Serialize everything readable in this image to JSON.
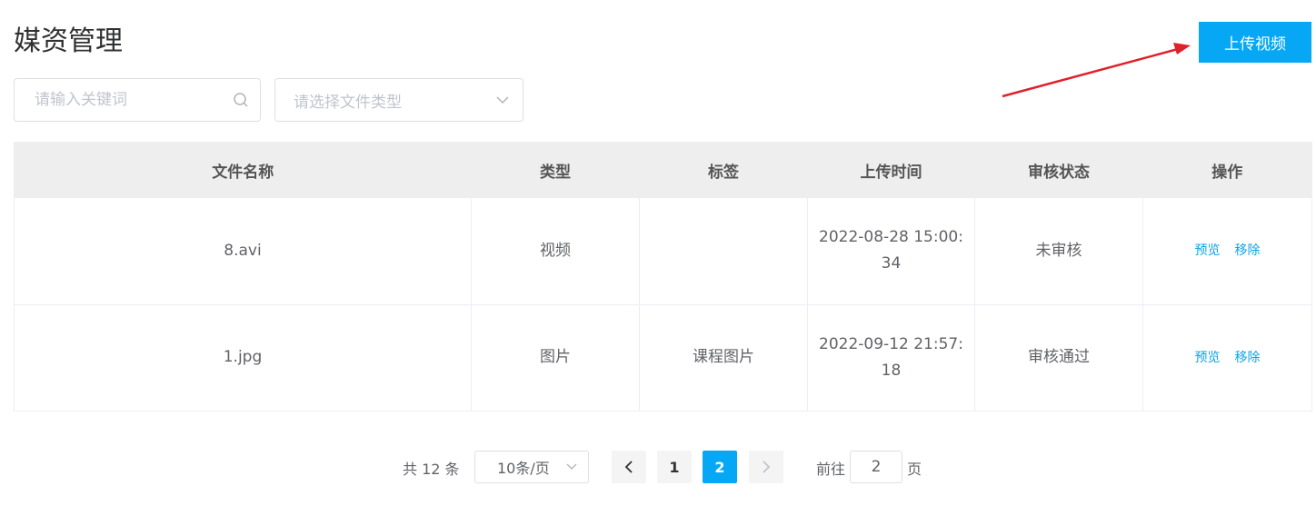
{
  "header": {
    "title": "媒资管理",
    "upload_label": "上传视频"
  },
  "filters": {
    "search_placeholder": "请输入关键词",
    "type_placeholder": "请选择文件类型"
  },
  "table": {
    "columns": [
      "文件名称",
      "类型",
      "标签",
      "上传时间",
      "审核状态",
      "操作"
    ],
    "rows": [
      {
        "name": "8.avi",
        "type": "视频",
        "tag": "",
        "time": "2022-08-28 15:00:34",
        "status": "未审核",
        "preview": "预览",
        "remove": "移除"
      },
      {
        "name": "1.jpg",
        "type": "图片",
        "tag": "课程图片",
        "time": "2022-09-12 21:57:18",
        "status": "审核通过",
        "preview": "预览",
        "remove": "移除"
      }
    ]
  },
  "pagination": {
    "total_text": "共 12 条",
    "page_size": "10条/页",
    "pages": [
      "1",
      "2"
    ],
    "goto_prefix": "前往",
    "goto_value": "2",
    "goto_suffix": "页"
  },
  "colors": {
    "accent": "#06a7f5",
    "link": "#0aa2e6",
    "annotation_arrow": "#e0202a"
  }
}
